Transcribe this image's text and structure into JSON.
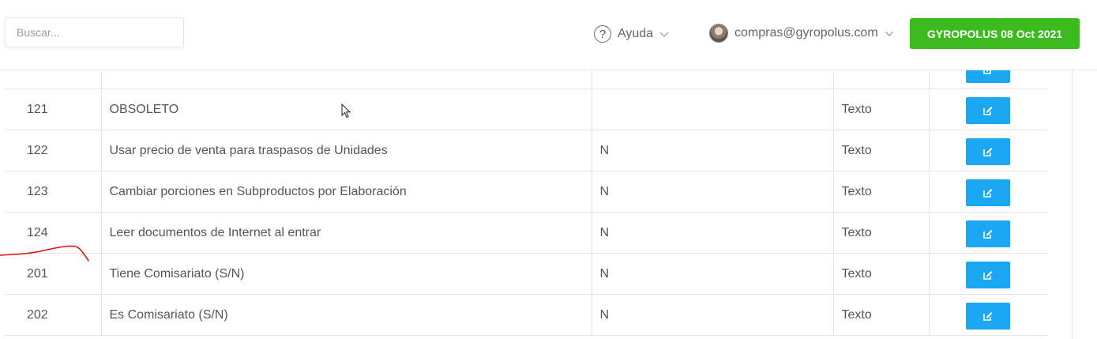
{
  "search": {
    "placeholder": "Buscar..."
  },
  "help": {
    "label": "Ayuda"
  },
  "user": {
    "email": "compras@gyropolus.com"
  },
  "company": {
    "label": "GYROPOLUS 08 Oct 2021"
  },
  "colors": {
    "accent_green": "#3cbb1e",
    "edit_blue": "#1aa8f2",
    "annotation_red": "#e01010"
  },
  "table": {
    "rows": [
      {
        "id": "",
        "description": "",
        "value": "",
        "type": ""
      },
      {
        "id": "121",
        "description": "OBSOLETO",
        "value": "",
        "type": "Texto"
      },
      {
        "id": "122",
        "description": "Usar precio de venta para traspasos de Unidades",
        "value": "N",
        "type": "Texto"
      },
      {
        "id": "123",
        "description": "Cambiar porciones en Subproductos por Elaboración",
        "value": "N",
        "type": "Texto"
      },
      {
        "id": "124",
        "description": "Leer documentos de Internet al entrar",
        "value": "N",
        "type": "Texto"
      },
      {
        "id": "201",
        "description": "Tiene Comisariato (S/N)",
        "value": "N",
        "type": "Texto"
      },
      {
        "id": "202",
        "description": "Es Comisariato (S/N)",
        "value": "N",
        "type": "Texto"
      }
    ]
  },
  "icons": {
    "help": "question-circle-icon",
    "chevron": "chevron-down-icon",
    "edit": "pencil-square-icon",
    "avatar": "user-avatar"
  }
}
